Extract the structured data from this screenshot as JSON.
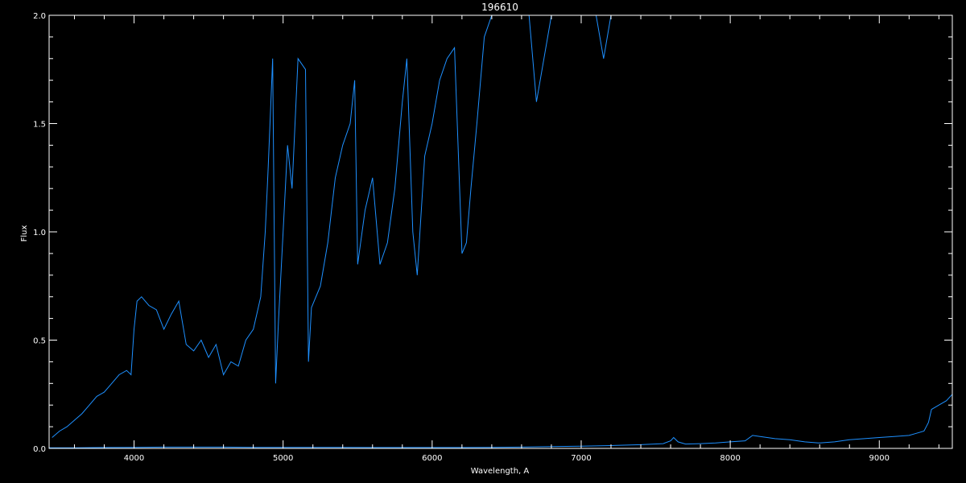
{
  "chart_data": {
    "type": "line",
    "title": "196610",
    "xlabel": "Wavelength, A",
    "ylabel": "Flux",
    "xlim": [
      3430,
      9490
    ],
    "ylim": [
      0.0,
      2.0
    ],
    "x_ticks": [
      4000,
      5000,
      6000,
      7000,
      8000,
      9000
    ],
    "x_tick_labels": [
      "4000",
      "5000",
      "6000",
      "7000",
      "8000",
      "9000"
    ],
    "y_ticks": [
      0.0,
      0.5,
      1.0,
      1.5,
      2.0
    ],
    "y_tick_labels": [
      "0.0",
      "0.5",
      "1.0",
      "1.5",
      "2.0"
    ],
    "grid": false,
    "background": "#000000",
    "axis_color": "#ffffff",
    "series": [
      {
        "color": "#1e90ff",
        "x": [
          3450,
          3500,
          3550,
          3600,
          3650,
          3700,
          3750,
          3800,
          3850,
          3900,
          3950,
          3980,
          4000,
          4020,
          4050,
          4100,
          4150,
          4200,
          4250,
          4300,
          4350,
          4400,
          4450,
          4500,
          4550,
          4600,
          4650,
          4700,
          4750,
          4800,
          4850,
          4880,
          4900,
          4930,
          4950,
          4970,
          5000,
          5030,
          5060,
          5100,
          5150,
          5170,
          5190,
          5250,
          5300,
          5350,
          5400,
          5450,
          5480,
          5500,
          5550,
          5600,
          5650,
          5700,
          5750,
          5800,
          5830,
          5870,
          5900,
          5950,
          6000,
          6050,
          6100,
          6150,
          6200,
          6230,
          6260,
          6300,
          6350,
          6400,
          6500,
          6600,
          6650,
          6700,
          6800,
          6900,
          7000,
          7100,
          7150,
          7200
        ],
        "y": [
          0.05,
          0.08,
          0.1,
          0.13,
          0.16,
          0.2,
          0.24,
          0.26,
          0.3,
          0.34,
          0.36,
          0.34,
          0.55,
          0.68,
          0.7,
          0.66,
          0.64,
          0.55,
          0.62,
          0.68,
          0.48,
          0.45,
          0.5,
          0.42,
          0.48,
          0.34,
          0.4,
          0.38,
          0.5,
          0.55,
          0.7,
          1.0,
          1.3,
          1.8,
          0.3,
          0.6,
          1.0,
          1.4,
          1.2,
          1.8,
          1.75,
          0.4,
          0.65,
          0.75,
          0.95,
          1.25,
          1.4,
          1.5,
          1.7,
          0.85,
          1.1,
          1.25,
          0.85,
          0.95,
          1.2,
          1.6,
          1.8,
          1.0,
          0.8,
          1.35,
          1.5,
          1.7,
          1.8,
          1.85,
          0.9,
          0.95,
          1.2,
          1.5,
          1.9,
          2.0,
          2.0,
          2.0,
          2.0,
          1.6,
          2.0,
          2.0,
          2.0,
          2.0,
          1.8,
          2.0
        ]
      },
      {
        "color": "#1e90ff",
        "x": [
          3430,
          3600,
          3800,
          4000,
          4200,
          4400,
          4600,
          4800,
          5000,
          5200,
          5400,
          5600,
          5800,
          6000,
          6200,
          6400,
          6600,
          6800,
          7000,
          7200,
          7400,
          7550,
          7600,
          7620,
          7650,
          7700,
          7800,
          7900,
          8000,
          8100,
          8150,
          8200,
          8300,
          8400,
          8500,
          8600,
          8700,
          8800,
          8900,
          9000,
          9100,
          9200,
          9250,
          9300,
          9330,
          9350,
          9400,
          9450,
          9490
        ],
        "y": [
          0.003,
          0.003,
          0.004,
          0.005,
          0.006,
          0.006,
          0.006,
          0.005,
          0.005,
          0.005,
          0.005,
          0.004,
          0.004,
          0.004,
          0.004,
          0.005,
          0.006,
          0.008,
          0.01,
          0.013,
          0.017,
          0.022,
          0.035,
          0.05,
          0.03,
          0.02,
          0.022,
          0.025,
          0.03,
          0.035,
          0.06,
          0.055,
          0.045,
          0.04,
          0.03,
          0.025,
          0.03,
          0.04,
          0.045,
          0.05,
          0.055,
          0.06,
          0.07,
          0.08,
          0.12,
          0.18,
          0.2,
          0.22,
          0.25
        ]
      }
    ]
  }
}
